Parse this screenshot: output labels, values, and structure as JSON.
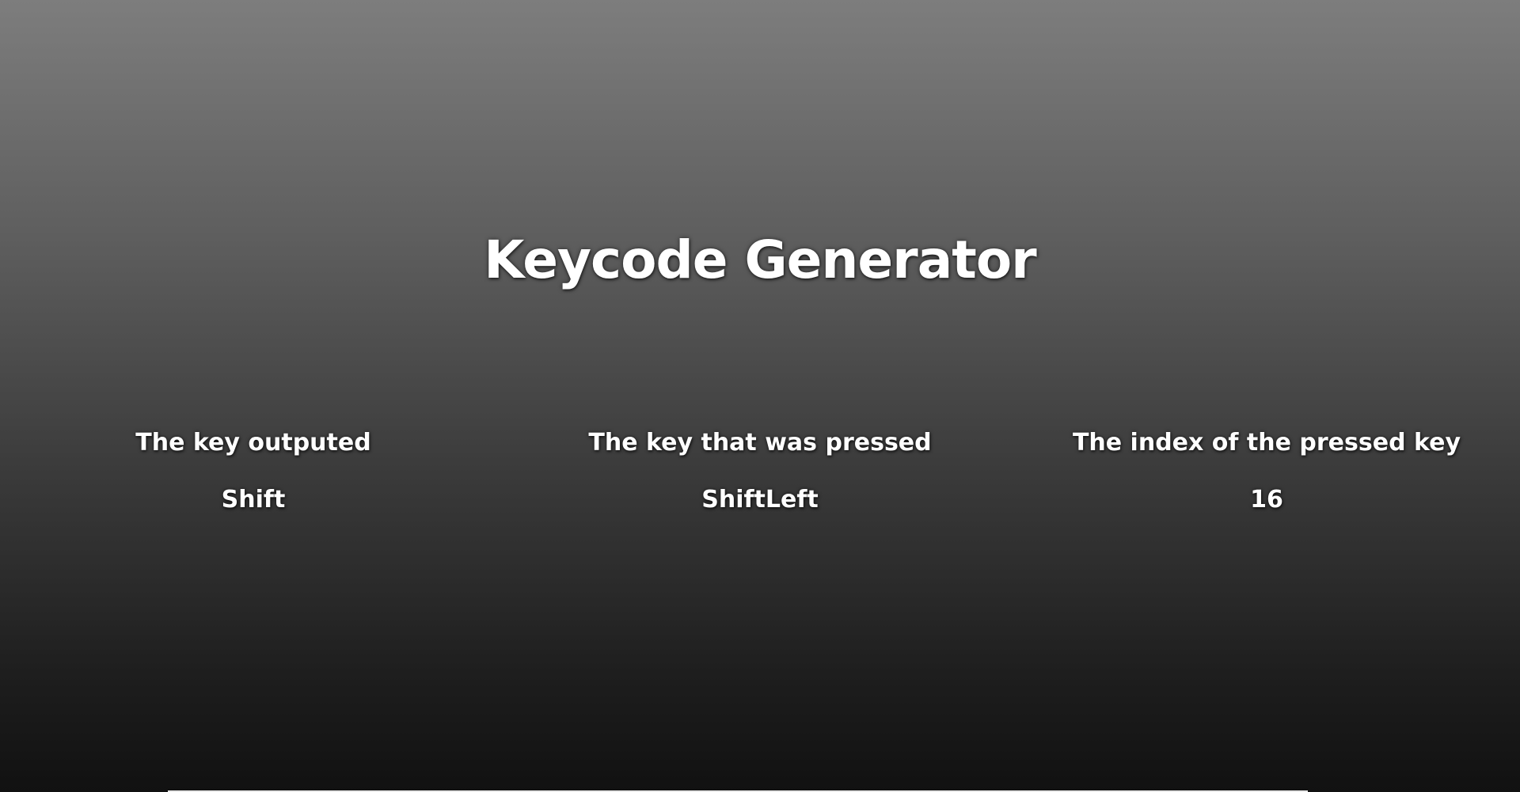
{
  "title": "Keycode Generator",
  "columns": [
    {
      "label": "The key outputed",
      "value": "Shift"
    },
    {
      "label": "The key that was pressed",
      "value": "ShiftLeft"
    },
    {
      "label": "The index of the pressed key",
      "value": "16"
    }
  ]
}
